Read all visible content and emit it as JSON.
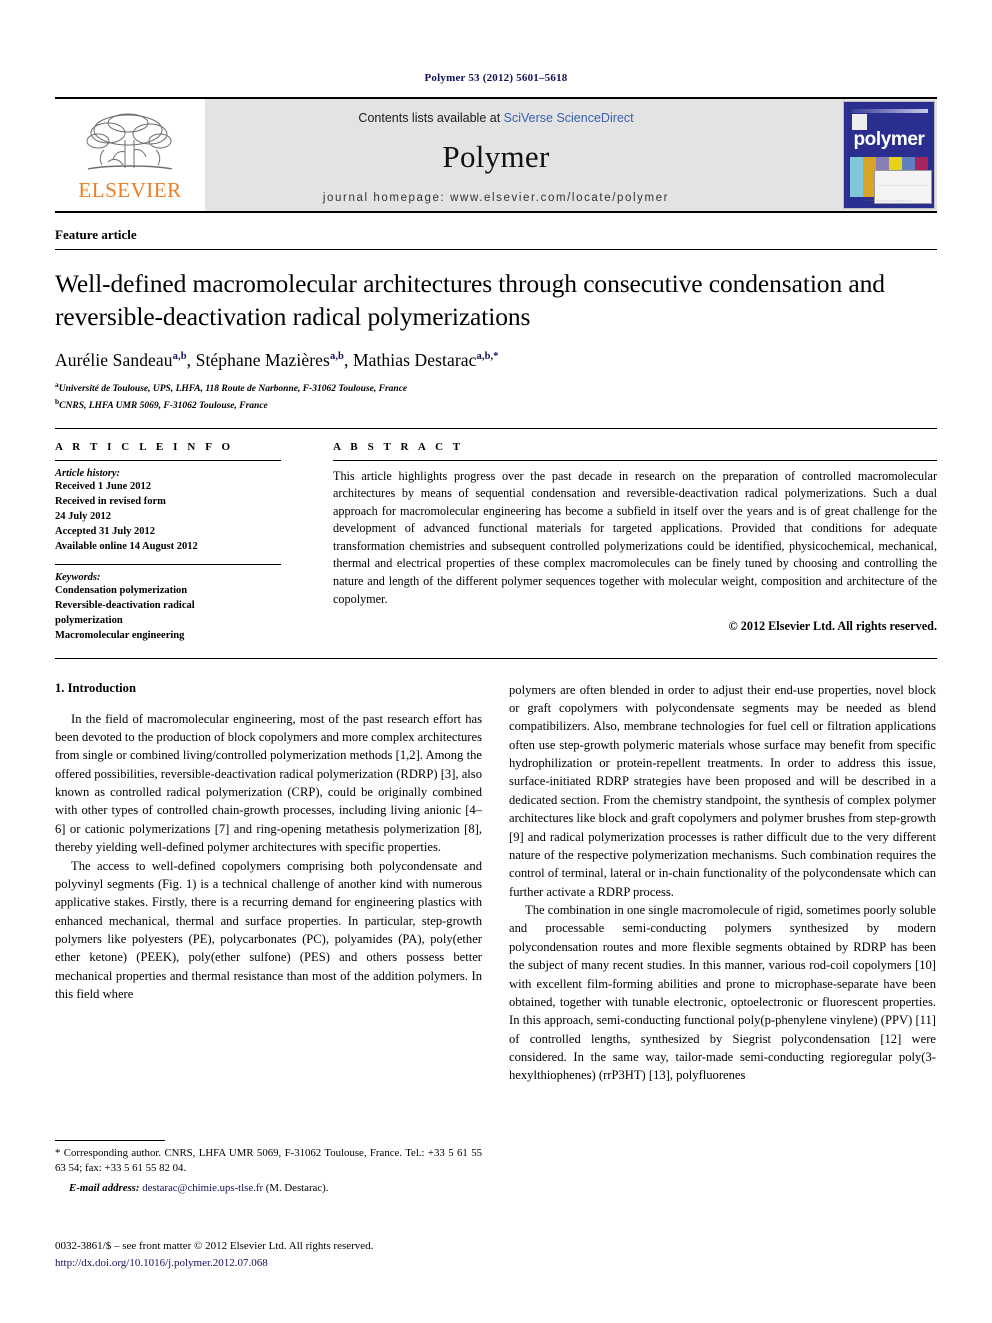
{
  "running_head": "Polymer 53 (2012) 5601–5618",
  "masthead": {
    "publisher_logo_name": "elsevier-tree-logo",
    "publisher_word": "ELSEVIER",
    "contents_prefix": "Contents lists available at ",
    "contents_link": "SciVerse ScienceDirect",
    "journal_name": "Polymer",
    "homepage": "journal homepage: www.elsevier.com/locate/polymer",
    "cover": {
      "title": "polymer",
      "footer": "· · · · ·\nSciVerse ScienceDirect"
    },
    "band_color": "#e3e3e3",
    "link_color": "#3c5fb0",
    "elsevier_orange": "#ef7d22"
  },
  "article": {
    "kind": "Feature article",
    "title": "Well-defined macromolecular architectures through consecutive condensation and reversible-deactivation radical polymerizations",
    "authors": [
      {
        "name": "Aurélie Sandeau",
        "marks": "a,b",
        "sep": ", "
      },
      {
        "name": "Stéphane Mazières",
        "marks": "a,b",
        "sep": ", "
      },
      {
        "name": "Mathias Destarac",
        "marks": "a,b,*",
        "sep": ""
      }
    ],
    "affiliations": [
      {
        "mark": "a",
        "text": "Université de Toulouse, UPS, LHFA, 118 Route de Narbonne, F-31062 Toulouse, France"
      },
      {
        "mark": "b",
        "text": "CNRS, LHFA UMR 5069, F-31062 Toulouse, France"
      }
    ]
  },
  "info": {
    "label": "A R T I C L E   I N F O",
    "history_title": "Article history:",
    "history": [
      "Received 1 June 2012",
      "Received in revised form",
      "24 July 2012",
      "Accepted 31 July 2012",
      "Available online 14 August 2012"
    ],
    "keywords_title": "Keywords:",
    "keywords": [
      "Condensation polymerization",
      "Reversible-deactivation radical",
      "polymerization",
      "Macromolecular engineering"
    ]
  },
  "abstract": {
    "label": "A B S T R A C T",
    "text": "This article highlights progress over the past decade in research on the preparation of controlled macromolecular architectures by means of sequential condensation and reversible-deactivation radical polymerizations. Such a dual approach for macromolecular engineering has become a subfield in itself over the years and is of great challenge for the development of advanced functional materials for targeted applications. Provided that conditions for adequate transformation chemistries and subsequent controlled polymerizations could be identified, physicochemical, mechanical, thermal and electrical properties of these complex macromolecules can be finely tuned by choosing and controlling the nature and length of the different polymer sequences together with molecular weight, composition and architecture of the copolymer.",
    "copyright": "© 2012 Elsevier Ltd. All rights reserved."
  },
  "body": {
    "section_number_title": "1. Introduction",
    "left_paragraphs": [
      "In the field of macromolecular engineering, most of the past research effort has been devoted to the production of block copolymers and more complex architectures from single or combined living/controlled polymerization methods [1,2]. Among the offered possibilities, reversible-deactivation radical polymerization (RDRP) [3], also known as controlled radical polymerization (CRP), could be originally combined with other types of controlled chain-growth processes, including living anionic [4–6] or cationic polymerizations [7] and ring-opening metathesis polymerization [8], thereby yielding well-defined polymer architectures with specific properties.",
      "The access to well-defined copolymers comprising both polycondensate and polyvinyl segments (Fig. 1) is a technical challenge of another kind with numerous applicative stakes. Firstly, there is a recurring demand for engineering plastics with enhanced mechanical, thermal and surface properties. In particular, step-growth polymers like polyesters (PE), polycarbonates (PC), polyamides (PA), poly(ether ether ketone) (PEEK), poly(ether sulfone) (PES) and others possess better mechanical properties and thermal resistance than most of the addition polymers. In this field where"
    ],
    "right_paragraphs": [
      "polymers are often blended in order to adjust their end-use properties, novel block or graft copolymers with polycondensate segments may be needed as blend compatibilizers. Also, membrane technologies for fuel cell or filtration applications often use step-growth polymeric materials whose surface may benefit from specific hydrophilization or protein-repellent treatments. In order to address this issue, surface-initiated RDRP strategies have been proposed and will be described in a dedicated section. From the chemistry standpoint, the synthesis of complex polymer architectures like block and graft copolymers and polymer brushes from step-growth [9] and radical polymerization processes is rather difficult due to the very different nature of the respective polymerization mechanisms. Such combination requires the control of terminal, lateral or in-chain functionality of the polycondensate which can further activate a RDRP process.",
      "The combination in one single macromolecule of rigid, sometimes poorly soluble and processable semi-conducting polymers synthesized by modern polycondensation routes and more flexible segments obtained by RDRP has been the subject of many recent studies. In this manner, various rod-coil copolymers [10] with excellent film-forming abilities and prone to microphase-separate have been obtained, together with tunable electronic, optoelectronic or fluorescent properties. In this approach, semi-conducting functional poly(p-phenylene vinylene) (PPV) [11] of controlled lengths, synthesized by Siegrist polycondensation [12] were considered. In the same way, tailor-made semi-conducting regioregular poly(3-hexylthiophenes) (rrP3HT) [13], polyfluorenes"
    ]
  },
  "footnotes": {
    "corresponding": "* Corresponding author. CNRS, LHFA UMR 5069, F-31062 Toulouse, France. Tel.: +33 5 61 55 63 54; fax: +33 5 61 55 82 04.",
    "email_label": "E-mail address:",
    "email_address": "destarac@chimie.ups-tlse.fr",
    "email_suffix": " (M. Destarac)."
  },
  "imprint": {
    "line1": "0032-3861/$ – see front matter © 2012 Elsevier Ltd. All rights reserved.",
    "doi": "http://dx.doi.org/10.1016/j.polymer.2012.07.068"
  }
}
